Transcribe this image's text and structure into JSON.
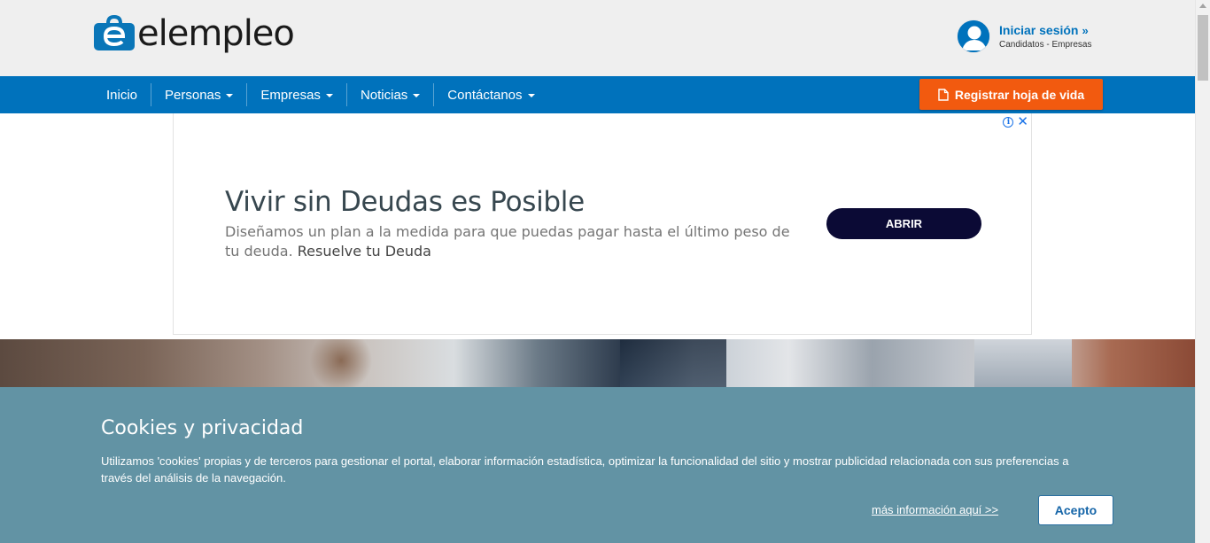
{
  "header": {
    "logo_text": "elempleo",
    "login": {
      "title": "Iniciar sesión",
      "subtitle": "Candidatos - Empresas"
    }
  },
  "nav": {
    "items": [
      {
        "label": "Inicio",
        "dropdown": false
      },
      {
        "label": "Personas",
        "dropdown": true
      },
      {
        "label": "Empresas",
        "dropdown": true
      },
      {
        "label": "Noticias",
        "dropdown": true
      },
      {
        "label": "Contáctanos",
        "dropdown": true
      }
    ],
    "cta_label": "Registrar hoja de vida"
  },
  "ad": {
    "title": "Vivir sin Deudas es Posible",
    "description": "Diseñamos un plan a la medida para que puedas pagar hasta el último peso de tu deuda.",
    "advertiser": "Resuelve tu Deuda",
    "button_label": "ABRIR",
    "info_glyph": "i",
    "close_glyph": "✕"
  },
  "cookie": {
    "title": "Cookies y privacidad",
    "text": "Utilizamos 'cookies' propias y de terceros para gestionar el portal, elaborar información estadística, optimizar la funcionalidad del sitio y mostrar publicidad relacionada con sus preferencias a través del análisis de la navegación.",
    "link_label": "más información aquí >>",
    "accept_label": "Acepto"
  },
  "colors": {
    "brand_blue": "#0072bc",
    "cta_orange": "#f25a0f",
    "cookie_bg": "#6293a4",
    "ad_button": "#0b0a35"
  },
  "icons": {
    "logo": "briefcase-e-logo-icon",
    "avatar": "user-avatar-icon",
    "login_chevron": "double-chevron-right-icon",
    "cta": "document-icon",
    "ad_info": "info-icon",
    "ad_close": "close-icon"
  }
}
